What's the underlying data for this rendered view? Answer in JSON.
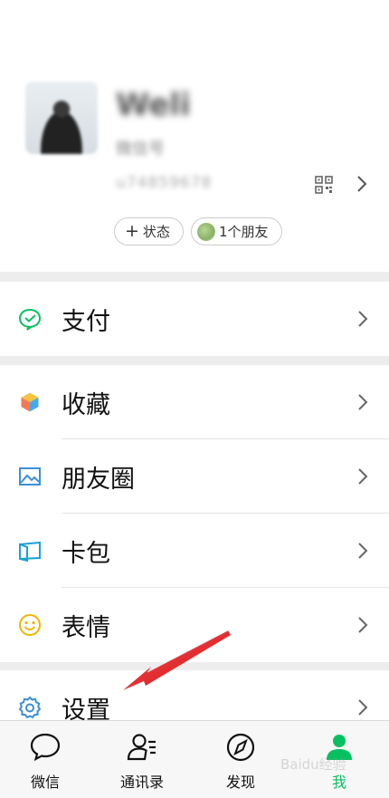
{
  "profile": {
    "nickname": "Weli",
    "wechat_id": "微信号",
    "account": "u74859678"
  },
  "status_pill": {
    "plus": "+",
    "label": "状态"
  },
  "friends_pill": {
    "label": "1个朋友"
  },
  "menu": {
    "pay": "支付",
    "favorites": "收藏",
    "moments": "朋友圈",
    "cards": "卡包",
    "stickers": "表情",
    "settings": "设置"
  },
  "tabs": {
    "chats": "微信",
    "contacts": "通讯录",
    "discover": "发现",
    "me": "我"
  },
  "watermark": "Baidu经验",
  "colors": {
    "accent": "#07c160",
    "arrow": "#e0262b",
    "favorites_icon": "#f5a623",
    "cards_icon": "#18a3d6",
    "settings_icon": "#3b8fd8",
    "stickers_icon": "#f0b400"
  }
}
